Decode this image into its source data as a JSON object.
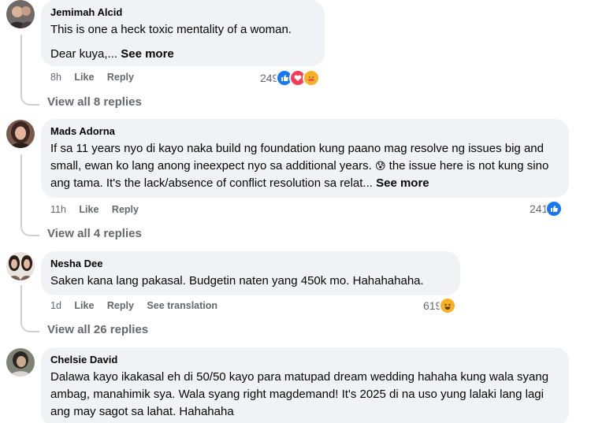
{
  "comments": [
    {
      "author": "Jemimah Alcid",
      "text": "This is one a heck toxic mentality of a woman.",
      "text2": "Dear kuya,...",
      "see_more": "See more",
      "time": "8h",
      "like": "Like",
      "reply": "Reply",
      "reaction_count": "249",
      "reactions": [
        "like-icon",
        "love-icon",
        "care-icon"
      ],
      "view_replies": "View all 8 replies"
    },
    {
      "author": "Mads Adorna",
      "text": "If sa 11 years nyo di kayo naka build ng foundation kung paano mag resolve ng issues big and small, ewan ko lang anong ineexpect nyo sa additional years.",
      "text_after_emoji": "the issue here is not kung sino ang tama. It's the lack/absence of conflict resolution sa relat...",
      "emoji": "😰",
      "see_more": "See more",
      "time": "11h",
      "like": "Like",
      "reply": "Reply",
      "reaction_count": "241",
      "reactions": [
        "like-icon"
      ],
      "view_replies": "View all 4 replies"
    },
    {
      "author": "Nesha Dee",
      "text": "Saken kana lang pakasal. Budgetin naten yang 450k mo. Hahahahaha.",
      "time": "1d",
      "like": "Like",
      "reply": "Reply",
      "see_translation": "See translation",
      "reaction_count": "619",
      "reactions": [
        "haha-icon"
      ],
      "view_replies": "View all 26 replies"
    },
    {
      "author": "Chelsie David",
      "text": "Dalawa kayo ikakasal eh di 50/50 kayo para matupad dream wedding hahaha kung wala syang ambag, manahimik sya. Wala syang right magdemand! It's 2025 di na uso yung lalaki lang lagi ang may sagot sa lahat. Hahahaha"
    }
  ],
  "colors": {
    "bubble": "#f0f2f5",
    "meta": "#65676b",
    "like_blue": "#1877f2",
    "love_red": "#f33e58",
    "haha_yellow": "#f7b125"
  }
}
